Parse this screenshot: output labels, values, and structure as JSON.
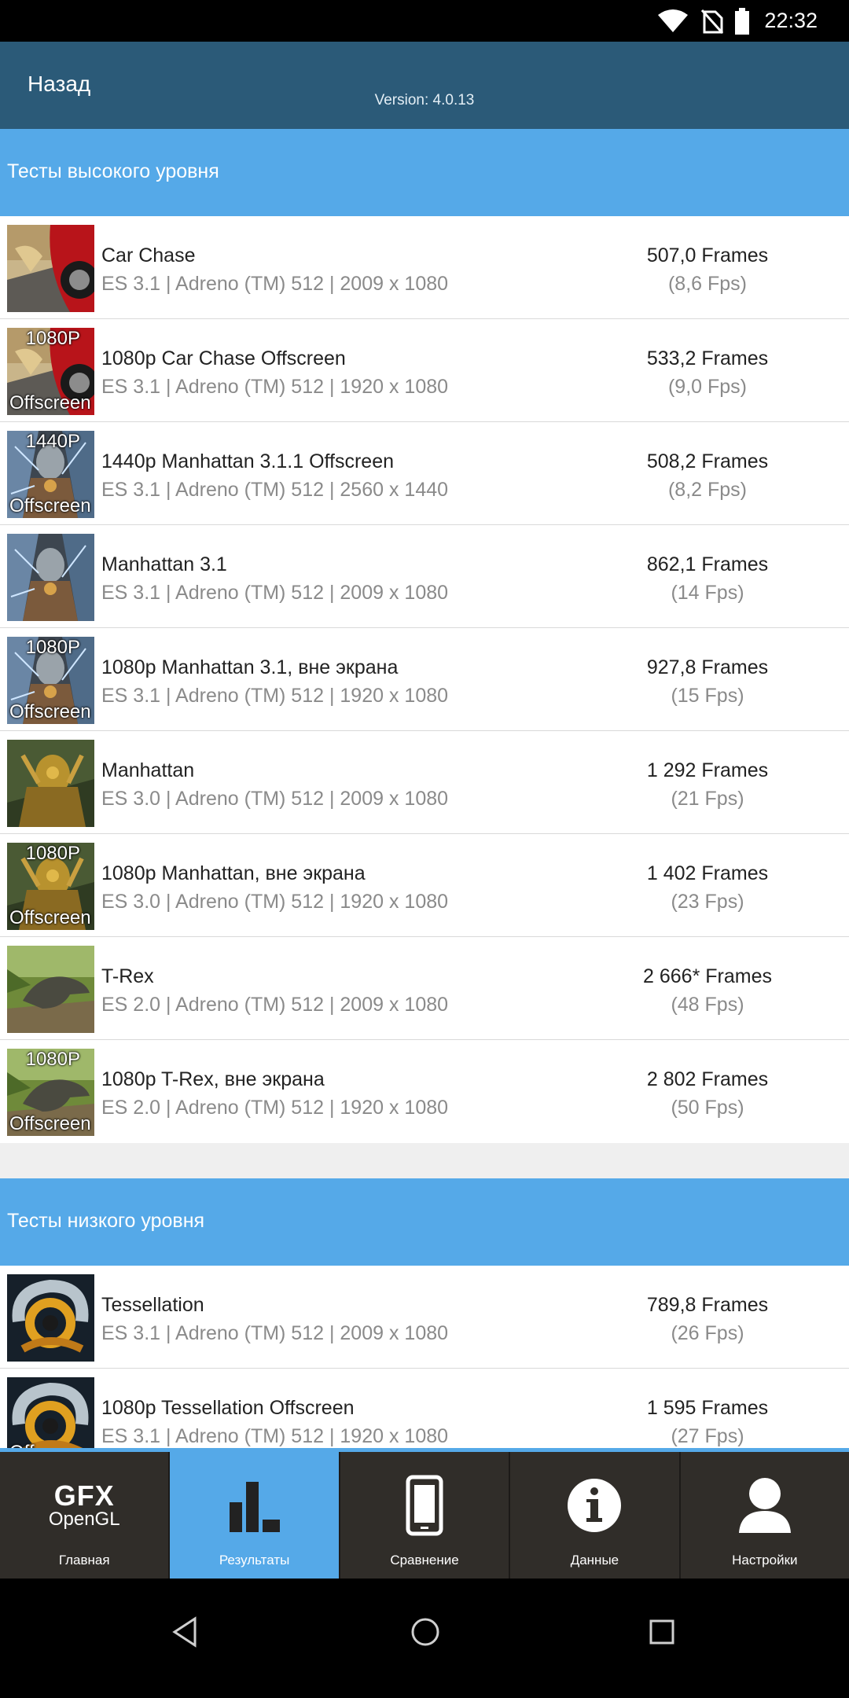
{
  "status_bar": {
    "time": "22:32",
    "icons": [
      "wifi-icon",
      "no-sim-icon",
      "battery-icon"
    ]
  },
  "header": {
    "back_label": "Назад",
    "version": "Version: 4.0.13"
  },
  "sections": [
    {
      "title": "Тесты высокого уровня",
      "rows": [
        {
          "name": "Car Chase",
          "detail": "ES 3.1 | Adreno (TM) 512 | 2009 x 1080",
          "score": "507,0 Frames",
          "fps": "(8,6 Fps)",
          "thumb": "car",
          "badge_res": "",
          "badge_off": ""
        },
        {
          "name": "1080p Car Chase Offscreen",
          "detail": "ES 3.1 | Adreno (TM) 512 | 1920 x 1080",
          "score": "533,2 Frames",
          "fps": "(9,0 Fps)",
          "thumb": "car",
          "badge_res": "1080P",
          "badge_off": "Offscreen"
        },
        {
          "name": "1440p Manhattan 3.1.1 Offscreen",
          "detail": "ES 3.1 | Adreno (TM) 512 | 2560 x 1440",
          "score": "508,2 Frames",
          "fps": "(8,2 Fps)",
          "thumb": "robot",
          "badge_res": "1440P",
          "badge_off": "Offscreen"
        },
        {
          "name": "Manhattan 3.1",
          "detail": "ES 3.1 | Adreno (TM) 512 | 2009 x 1080",
          "score": "862,1 Frames",
          "fps": "(14 Fps)",
          "thumb": "robot",
          "badge_res": "",
          "badge_off": ""
        },
        {
          "name": "1080p Manhattan 3.1, вне экрана",
          "detail": "ES 3.1 | Adreno (TM) 512 | 1920 x 1080",
          "score": "927,8 Frames",
          "fps": "(15 Fps)",
          "thumb": "robot",
          "badge_res": "1080P",
          "badge_off": "Offscreen"
        },
        {
          "name": "Manhattan",
          "detail": "ES 3.0 | Adreno (TM) 512 | 2009 x 1080",
          "score": "1 292 Frames",
          "fps": "(21 Fps)",
          "thumb": "mech",
          "badge_res": "",
          "badge_off": ""
        },
        {
          "name": "1080p Manhattan, вне экрана",
          "detail": "ES 3.0 | Adreno (TM) 512 | 1920 x 1080",
          "score": "1 402 Frames",
          "fps": "(23 Fps)",
          "thumb": "mech",
          "badge_res": "1080P",
          "badge_off": "Offscreen"
        },
        {
          "name": "T-Rex",
          "detail": "ES 2.0 | Adreno (TM) 512 | 2009 x 1080",
          "score": "2 666* Frames",
          "fps": "(48 Fps)",
          "thumb": "trex",
          "badge_res": "",
          "badge_off": ""
        },
        {
          "name": "1080p T-Rex, вне экрана",
          "detail": "ES 2.0 | Adreno (TM) 512 | 1920 x 1080",
          "score": "2 802 Frames",
          "fps": "(50 Fps)",
          "thumb": "trex",
          "badge_res": "1080P",
          "badge_off": "Offscreen"
        }
      ]
    },
    {
      "title": "Тесты низкого уровня",
      "rows": [
        {
          "name": "Tessellation",
          "detail": "ES 3.1 | Adreno (TM) 512 | 2009 x 1080",
          "score": "789,8 Frames",
          "fps": "(26 Fps)",
          "thumb": "tess",
          "badge_res": "",
          "badge_off": ""
        },
        {
          "name": "1080p Tessellation Offscreen",
          "detail": "ES 3.1 | Adreno (TM) 512 | 1920 x 1080",
          "score": "1 595 Frames",
          "fps": "(27 Fps)",
          "thumb": "tess",
          "badge_res": "",
          "badge_off": "Off"
        }
      ]
    }
  ],
  "tabs": [
    {
      "label": "Главная",
      "icon": "gfx-opengl-logo",
      "logo_big": "GFX",
      "logo_small": "OpenGL",
      "active": false
    },
    {
      "label": "Результаты",
      "icon": "bar-chart-icon",
      "active": true
    },
    {
      "label": "Сравнение",
      "icon": "phone-icon",
      "active": false
    },
    {
      "label": "Данные",
      "icon": "info-icon",
      "active": false
    },
    {
      "label": "Настройки",
      "icon": "user-icon",
      "active": false
    }
  ],
  "nav_bar": {
    "buttons": [
      "back-icon",
      "home-icon",
      "recents-icon"
    ]
  }
}
